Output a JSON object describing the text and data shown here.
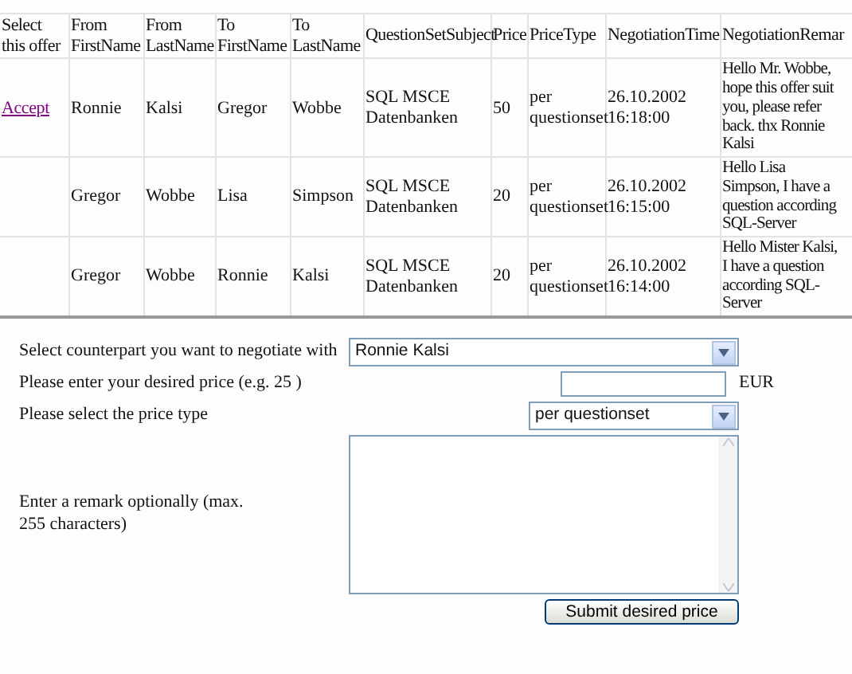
{
  "offers_table": {
    "columns": [
      "Select this offer",
      "From FirstName",
      "From LastName",
      "To FirstName",
      "To LastName",
      "QuestionSetSubject",
      "Price",
      "PriceType",
      "NegotiationTime",
      "NegotiationRemar"
    ],
    "rows": [
      {
        "cells": [
          "Accept",
          "Ronnie",
          "Kalsi",
          "Gregor",
          "Wobbe",
          "SQL MSCE Datenbanken",
          "50",
          "per questionset",
          "26.10.2002 16:18:00",
          "Hello Mr. Wobbe,\nhope this offer suit\nyou, please refer\nback. thx Ronnie\nKalsi"
        ]
      },
      {
        "cells": [
          "",
          "Gregor",
          "Wobbe",
          "Lisa",
          "Simpson",
          "SQL MSCE Datenbanken",
          "20",
          "per questionset",
          "26.10.2002 16:15:00",
          "Hello Lisa\nSimpson, I have a\nquestion according\nSQL-Server"
        ]
      },
      {
        "cells": [
          "",
          "Gregor",
          "Wobbe",
          "Ronnie",
          "Kalsi",
          "SQL MSCE Datenbanken",
          "20",
          "per questionset",
          "26.10.2002 16:14:00",
          "Hello Mister Kalsi,\nI have a question\naccording SQL-\nServer"
        ]
      }
    ]
  },
  "form": {
    "counterpart": {
      "label": "Select counterpart you want to negotiate with",
      "value": "Ronnie Kalsi"
    },
    "price": {
      "label": "Please enter your desired price (e.g. 25 )",
      "unit": "EUR"
    },
    "price_type": {
      "label": "Please select the price type",
      "value": "per questionset"
    },
    "remark": {
      "label": "Enter a remark optionally (max. 255 characters)"
    },
    "submit": "Submit desired price"
  }
}
